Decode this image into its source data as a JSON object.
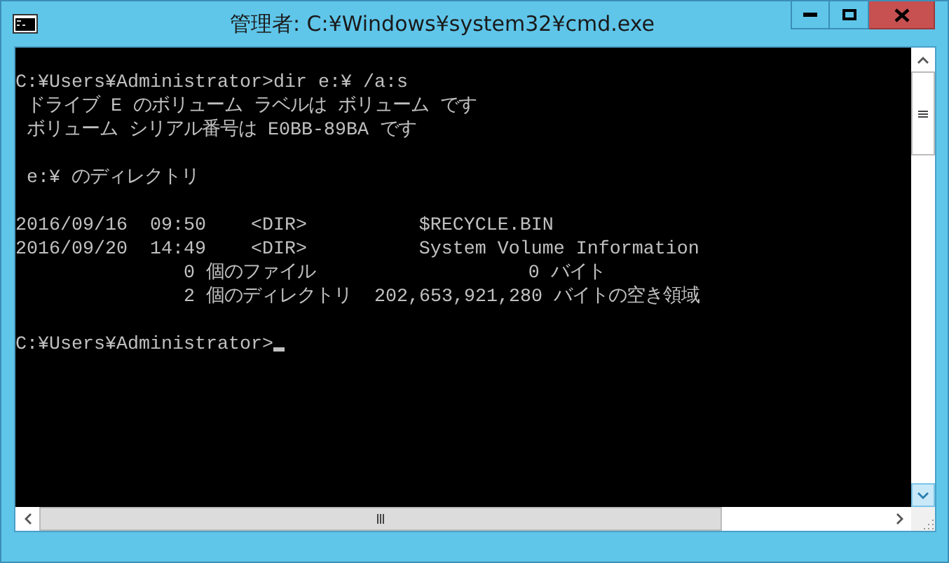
{
  "window": {
    "title": "管理者: C:¥Windows¥system32¥cmd.exe"
  },
  "console": {
    "blocks": [
      {
        "lines": [
          {
            "text": "C:¥Users¥Administrator>dir e:¥ /a:s",
            "cursor": false
          },
          {
            "text": " ドライブ E のボリューム ラベルは ボリューム です",
            "cursor": false
          },
          {
            "text": " ボリューム シリアル番号は E0BB-89BA です",
            "cursor": false
          }
        ]
      },
      {
        "lines": [
          {
            "text": " e:¥ のディレクトリ",
            "cursor": false
          }
        ]
      },
      {
        "lines": [
          {
            "text": "2016/09/16  09:50    <DIR>          $RECYCLE.BIN",
            "cursor": false
          },
          {
            "text": "2016/09/20  14:49    <DIR>          System Volume Information",
            "cursor": false
          },
          {
            "text": "               0 個のファイル                   0 バイト",
            "cursor": false
          },
          {
            "text": "               2 個のディレクトリ  202,653,921,280 バイトの空き領域",
            "cursor": false
          }
        ]
      },
      {
        "lines": [
          {
            "text": "C:¥Users¥Administrator>",
            "cursor": true
          }
        ]
      }
    ]
  }
}
